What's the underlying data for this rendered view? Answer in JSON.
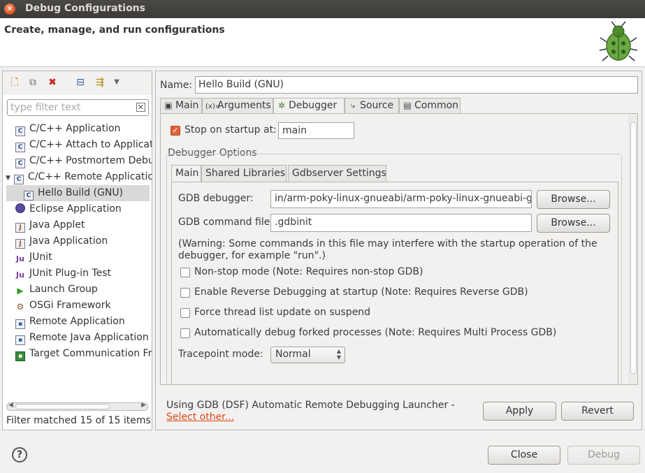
{
  "window": {
    "title": "Debug Configurations",
    "close_icon": "close-icon"
  },
  "header": {
    "title": "Create, manage, and run configurations",
    "icon": "bug-icon"
  },
  "toolbar": {
    "icons": [
      "new-config-icon",
      "duplicate-icon",
      "delete-icon",
      "collapse-all-icon",
      "filter-icon",
      "dropdown-arrow-icon"
    ]
  },
  "filter": {
    "placeholder": "type filter text"
  },
  "tree": {
    "items": [
      {
        "label": "C/C++ Application",
        "icon": "c-config-icon"
      },
      {
        "label": "C/C++ Attach to Applicati",
        "icon": "c-config-icon"
      },
      {
        "label": "C/C++ Postmortem Debug",
        "icon": "c-config-icon"
      },
      {
        "label": "C/C++ Remote Application",
        "icon": "c-config-icon",
        "expanded": true
      },
      {
        "label": "Hello Build (GNU)",
        "icon": "c-config-icon",
        "selected": true,
        "child": true
      },
      {
        "label": "Eclipse Application",
        "icon": "eclipse-icon"
      },
      {
        "label": "Java Applet",
        "icon": "java-applet-icon"
      },
      {
        "label": "Java Application",
        "icon": "java-app-icon"
      },
      {
        "label": "JUnit",
        "icon": "junit-icon"
      },
      {
        "label": "JUnit Plug-in Test",
        "icon": "junit-plugin-icon"
      },
      {
        "label": "Launch Group",
        "icon": "launch-group-icon"
      },
      {
        "label": "OSGi Framework",
        "icon": "osgi-icon"
      },
      {
        "label": "Remote Application",
        "icon": "remote-app-icon"
      },
      {
        "label": "Remote Java Application",
        "icon": "remote-java-icon"
      },
      {
        "label": "Target Communication Fra",
        "icon": "target-comm-icon"
      }
    ]
  },
  "status": "Filter matched 15 of 15 items",
  "config": {
    "name_label": "Name:",
    "name_value": "Hello Build (GNU)",
    "tabs": [
      {
        "label": "Main",
        "icon": "main-tab-icon"
      },
      {
        "label": "Arguments",
        "icon": "arguments-icon"
      },
      {
        "label": "Debugger",
        "icon": "debugger-icon",
        "active": true
      },
      {
        "label": "Source",
        "icon": "source-icon"
      },
      {
        "label": "Common",
        "icon": "common-icon"
      }
    ],
    "stop_on_startup_label": "Stop on startup at:",
    "stop_on_startup_checked": true,
    "stop_on_startup_value": "main",
    "debugger_options_label": "Debugger Options",
    "subtabs": [
      {
        "label": "Main",
        "active": true
      },
      {
        "label": "Shared Libraries"
      },
      {
        "label": "Gdbserver Settings"
      }
    ],
    "gdb_debugger_label": "GDB debugger:",
    "gdb_debugger_value": "in/arm-poky-linux-gnueabi/arm-poky-linux-gnueabi-gdb",
    "gdb_command_file_label": "GDB command file:",
    "gdb_command_file_value": ".gdbinit",
    "browse_label": "Browse...",
    "warning": "(Warning: Some commands in this file may interfere with the startup operation of the debugger, for example \"run\".)",
    "options": [
      {
        "label": "Non-stop mode (Note: Requires non-stop GDB)",
        "checked": false
      },
      {
        "label": "Enable Reverse Debugging at startup (Note: Requires Reverse GDB)",
        "checked": false
      },
      {
        "label": "Force thread list update on suspend",
        "checked": false
      },
      {
        "label": "Automatically debug forked processes (Note: Requires Multi Process GDB)",
        "checked": false
      }
    ],
    "tracepoint_label": "Tracepoint mode:",
    "tracepoint_value": "Normal"
  },
  "launcher": {
    "text": "Using GDB (DSF) Automatic Remote Debugging Launcher - ",
    "link": "Select other..."
  },
  "buttons": {
    "apply": "Apply",
    "revert": "Revert",
    "close": "Close",
    "debug": "Debug"
  },
  "help_icon": "help-icon"
}
